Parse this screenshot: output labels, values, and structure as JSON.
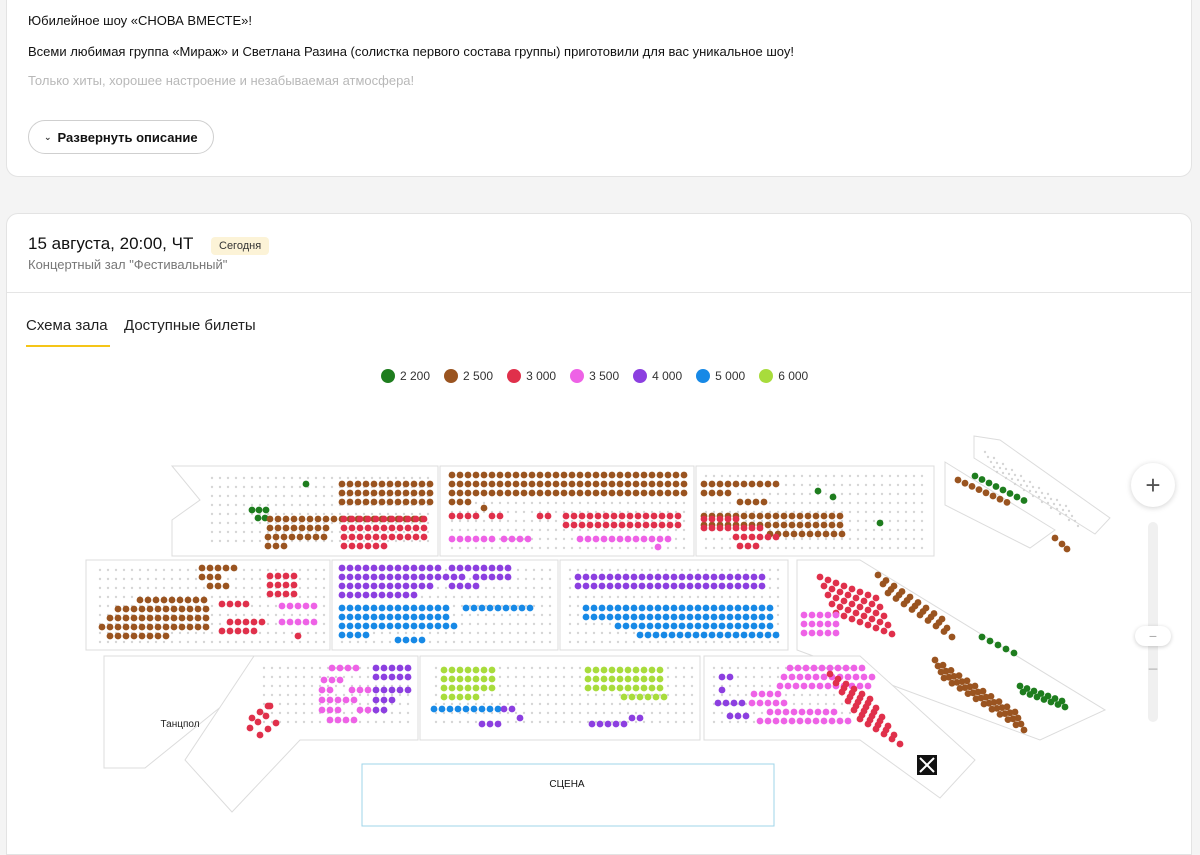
{
  "description": {
    "line1": "Юбилейное шоу «СНОВА ВМЕСТЕ»!",
    "line2": "Всеми любимая группа «Мираж» и Светлана Разина (солистка первого состава группы) приготовили для вас уникальное шоу!",
    "line3": "Только хиты, хорошее настроение и незабываемая атмосфера!",
    "expand_label": "Развернуть описание"
  },
  "event": {
    "date": "15 августа, 20:00, ЧТ",
    "badge": "Сегодня",
    "venue": "Концертный зал \"Фестивальный\""
  },
  "tabs": [
    {
      "label": "Схема зала",
      "active": true
    },
    {
      "label": "Доступные билеты",
      "active": false
    }
  ],
  "legend": [
    {
      "price": "2 200",
      "color": "#1e7d1e"
    },
    {
      "price": "2 500",
      "color": "#9a5420"
    },
    {
      "price": "3 000",
      "color": "#e0304b"
    },
    {
      "price": "3 500",
      "color": "#ee62e6"
    },
    {
      "price": "4 000",
      "color": "#8c3fe0"
    },
    {
      "price": "5 000",
      "color": "#1789e6"
    },
    {
      "price": "6 000",
      "color": "#a8dc3c"
    }
  ],
  "hall": {
    "stage_label": "СЦЕНА",
    "dance_floor_label": "Танцпол",
    "unavailable_seat_color": "#d6d6d6"
  },
  "zoom": {
    "plus_icon": "+",
    "minus_icon": "−",
    "knob_icon": "−"
  }
}
